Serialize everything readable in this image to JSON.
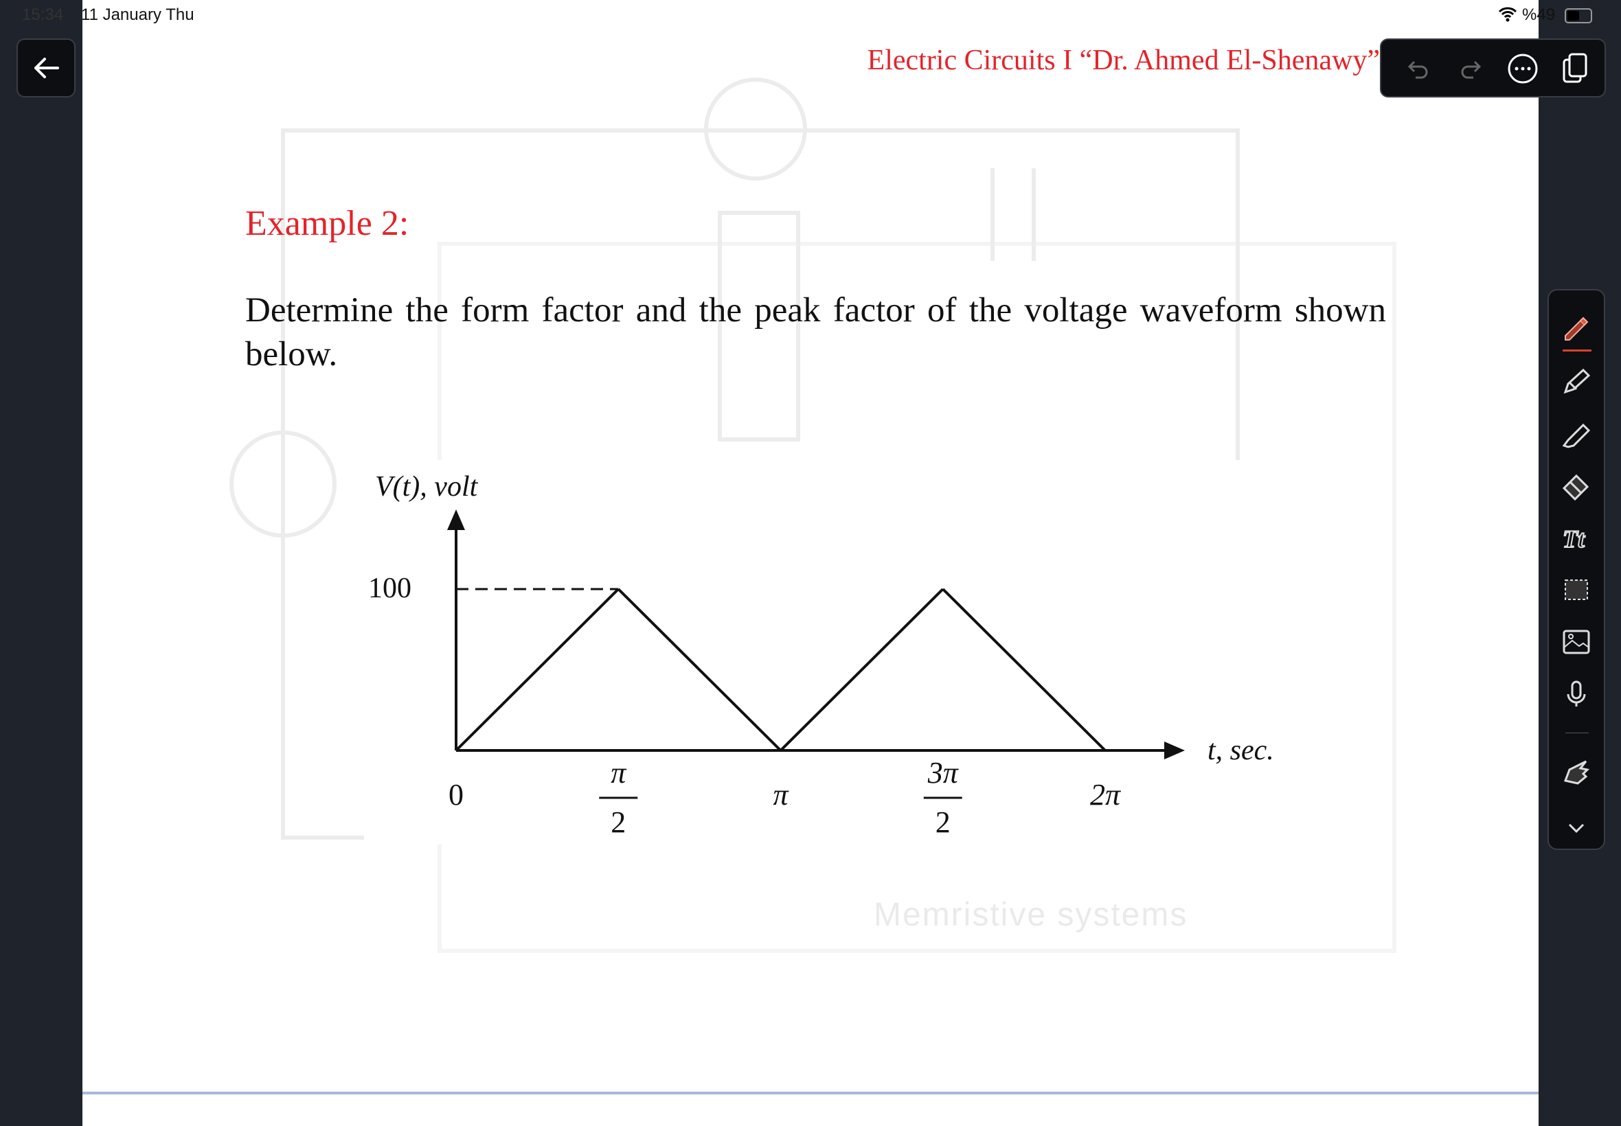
{
  "status_bar": {
    "time": "15:34",
    "date": "11 January Thu",
    "battery": "%49",
    "wifi_icon": "wifi-icon",
    "battery_icon": "battery-icon"
  },
  "toolbar": {
    "back_icon": "arrow-left-icon",
    "undo_icon": "undo-icon",
    "redo_icon": "redo-icon",
    "more_icon": "more-ellipsis-icon",
    "pages_icon": "pages-icon"
  },
  "document": {
    "header": "Electric Circuits I  “Dr. Ahmed El-Shenawy”",
    "example_title": "Example 2:",
    "question": "Determine the form factor and the peak factor of the voltage waveform shown below.",
    "watermark": "Memristive systems",
    "accent_color": "#e3242b"
  },
  "tools": [
    "pen-icon",
    "pencil-icon",
    "highlighter-icon",
    "eraser-icon",
    "text-tool-icon",
    "lasso-select-icon",
    "image-icon",
    "microphone-icon",
    "hand-pointer-icon",
    "chevron-down-icon"
  ],
  "active_tool_color": "#d9412b",
  "chart_data": {
    "type": "line",
    "ylabel": "V(t), volt",
    "xlabel": "t, sec.",
    "x": [
      0,
      1.5708,
      3.1416,
      4.7124,
      6.2832
    ],
    "y": [
      0,
      100,
      0,
      100,
      0
    ],
    "y_ticks": [
      "100"
    ],
    "x_ticks": [
      {
        "value": 0,
        "label": "0"
      },
      {
        "value": 1.5708,
        "num": "π",
        "den": "2"
      },
      {
        "value": 3.1416,
        "label": "π"
      },
      {
        "value": 4.7124,
        "num": "3π",
        "den": "2"
      },
      {
        "value": 6.2832,
        "label": "2π"
      }
    ],
    "xlim": [
      0,
      6.2832
    ],
    "ylim": [
      0,
      100
    ],
    "dashed_reference": {
      "y": 100,
      "to_x": 1.5708
    },
    "grid": false
  }
}
